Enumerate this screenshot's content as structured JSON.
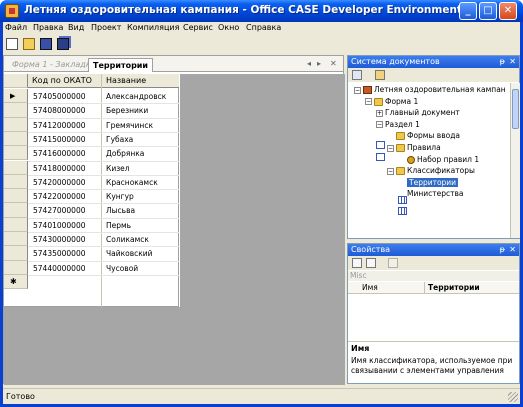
{
  "window": {
    "title": "Летняя оздоровительная кампания - Office CASE Developer Environment",
    "minimize": "_",
    "maximize": "□",
    "close": "✕"
  },
  "menu": [
    "Файл",
    "Правка",
    "Вид",
    "Проект",
    "Компиляция",
    "Сервис",
    "Окно",
    "Справка"
  ],
  "toolbar": {
    "icons": [
      "new-file-icon",
      "open-folder-icon",
      "save-icon",
      "save-all-icon"
    ]
  },
  "document": {
    "tabs": [
      {
        "label": "Форма 1 - Закладк",
        "active": false
      },
      {
        "label": "Территории",
        "active": true
      }
    ],
    "tab_nav": {
      "prev": "◂",
      "next": "▸",
      "close": "✕"
    },
    "grid": {
      "columns": [
        "Код по ОКАТО",
        "Название"
      ],
      "current_row_marker": "▶",
      "new_row_marker": "✱",
      "rows": [
        [
          "57405000000",
          "Александровск"
        ],
        [
          "57408000000",
          "Березники"
        ],
        [
          "57412000000",
          "Гремячинск"
        ],
        [
          "57415000000",
          "Губаха"
        ],
        [
          "57416000000",
          "Добрянка"
        ],
        [
          "57418000000",
          "Кизел"
        ],
        [
          "57420000000",
          "Краснокамск"
        ],
        [
          "57422000000",
          "Кунгур"
        ],
        [
          "57427000000",
          "Лысьва"
        ],
        [
          "57401000000",
          "Пермь"
        ],
        [
          "57430000000",
          "Соликамск"
        ],
        [
          "57435000000",
          "Чайковский"
        ],
        [
          "57440000000",
          "Чусовой"
        ]
      ]
    }
  },
  "doc_system": {
    "title": "Система документов",
    "pin": "ᵽ",
    "close": "✕",
    "tree": [
      {
        "label": "Летняя оздоровительная кампан",
        "level": 0,
        "icon": "root",
        "exp": "−"
      },
      {
        "label": "Форма 1",
        "level": 1,
        "icon": "folder",
        "exp": "−"
      },
      {
        "label": "Главный документ",
        "level": 2,
        "icon": "doc",
        "exp": "+"
      },
      {
        "label": "Раздел 1",
        "level": 2,
        "icon": "doc",
        "exp": "−"
      },
      {
        "label": "Формы ввода",
        "level": 3,
        "icon": "folder",
        "exp": ""
      },
      {
        "label": "Правила",
        "level": 3,
        "icon": "folder",
        "exp": "−"
      },
      {
        "label": "Набор правил 1",
        "level": 4,
        "icon": "key",
        "exp": ""
      },
      {
        "label": "Классификаторы",
        "level": 3,
        "icon": "folder",
        "exp": "−"
      },
      {
        "label": "Территории",
        "level": 4,
        "icon": "grid",
        "exp": "",
        "selected": true
      },
      {
        "label": "Министерства",
        "level": 4,
        "icon": "grid",
        "exp": ""
      }
    ]
  },
  "properties": {
    "title": "Свойства",
    "pin": "ᵽ",
    "close": "✕",
    "section": "Misc",
    "rows": [
      {
        "name": "Имя",
        "value": "Территории"
      }
    ],
    "description_title": "Имя",
    "description": "Имя классификатора, используемое при связывании с элементами управления"
  },
  "status": {
    "text": "Готово"
  }
}
